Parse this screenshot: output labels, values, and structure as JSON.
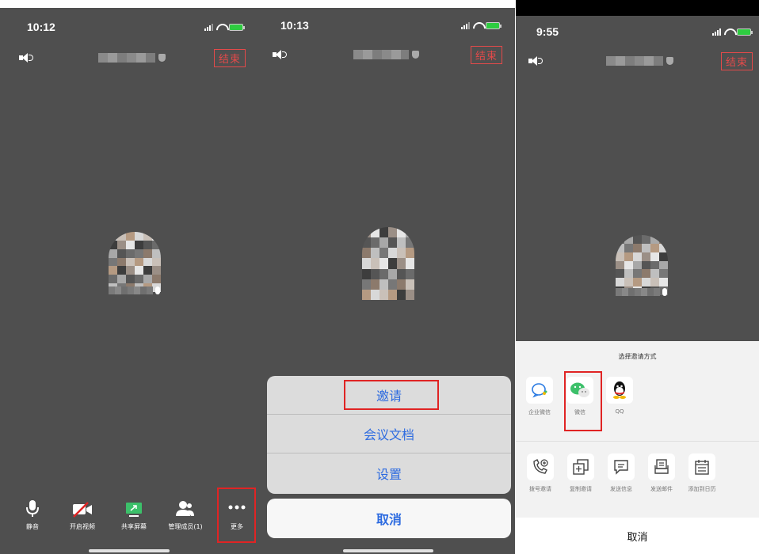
{
  "colors": {
    "panel_bg": "#4f4f4f",
    "end_red": "#e34a4a",
    "highlight_red": "#e02424",
    "sheet_blue": "#2d6be0",
    "battery_green": "#2ecc40"
  },
  "panel1": {
    "time": "10:12",
    "end_label": "结束",
    "toolbar": [
      {
        "icon": "microphone-icon",
        "label": "静音"
      },
      {
        "icon": "video-off-icon",
        "label": "开启视频"
      },
      {
        "icon": "share-screen-icon",
        "label": "共享屏幕"
      },
      {
        "icon": "manage-members-icon",
        "label": "管理成员(1)"
      },
      {
        "icon": "more-icon",
        "label": "更多"
      }
    ]
  },
  "panel2": {
    "time": "10:13",
    "end_label": "结束",
    "sheet_items": [
      "邀请",
      "会议文档",
      "设置"
    ],
    "cancel_label": "取消"
  },
  "panel3": {
    "time": "9:55",
    "end_label": "结束",
    "share_title": "选择邀请方式",
    "row1": [
      {
        "icon": "wecom-icon",
        "label": "企业微信"
      },
      {
        "icon": "wechat-icon",
        "label": "微信"
      },
      {
        "icon": "qq-icon",
        "label": "QQ"
      }
    ],
    "row2": [
      {
        "icon": "phone-invite-icon",
        "label": "拨号邀请"
      },
      {
        "icon": "copy-invite-icon",
        "label": "复制邀请"
      },
      {
        "icon": "message-icon",
        "label": "发送信息"
      },
      {
        "icon": "mail-icon",
        "label": "发送邮件"
      },
      {
        "icon": "calendar-icon",
        "label": "添加到日历"
      }
    ],
    "cancel_label": "取消"
  }
}
